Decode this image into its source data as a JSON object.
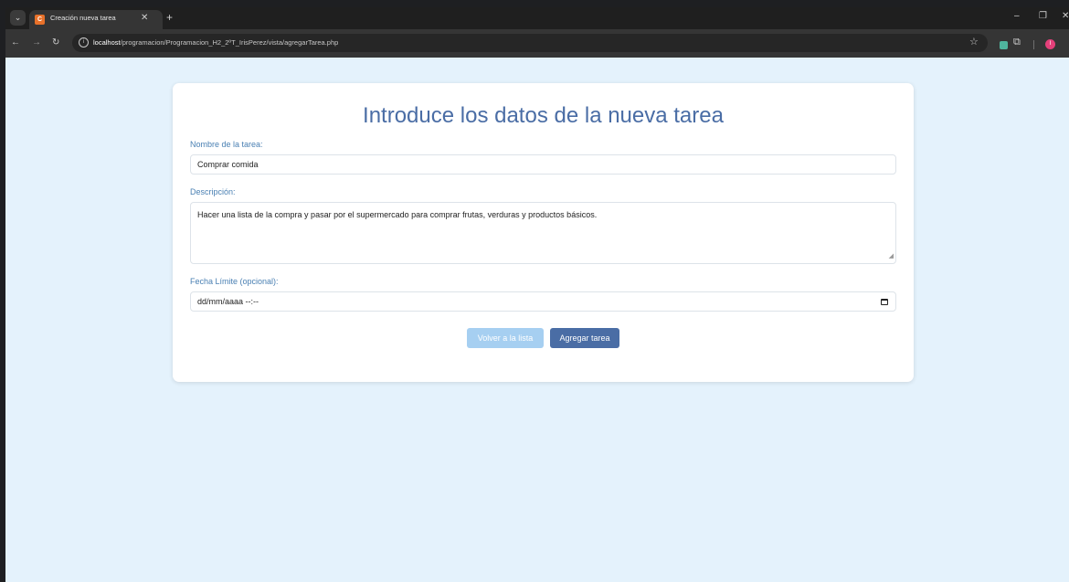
{
  "browser": {
    "tab_title": "Creación nueva tarea",
    "tab_favicon_letter": "C",
    "url_host": "localhost",
    "url_path": "/programacion/Programacion_H2_2ºT_IrisPerez/vista/agregarTarea.php",
    "profile_initial": "I",
    "icons": [
      "tab-search-icon",
      "close-icon",
      "plus-icon",
      "back-arrow-icon",
      "forward-arrow-icon",
      "reload-icon",
      "site-info-icon",
      "bookmark-star-icon",
      "extension-icon",
      "puzzle-icon",
      "minimize-icon",
      "maximize-icon",
      "window-close-icon"
    ]
  },
  "form": {
    "heading": "Introduce los datos de la nueva tarea",
    "name_label": "Nombre de la tarea:",
    "name_value": "Comprar comida",
    "description_label": "Descripción:",
    "description_value": "Hacer una lista de la compra y pasar por el supermercado para comprar frutas, verduras y productos básicos.",
    "date_label": "Fecha Límite (opcional):",
    "date_placeholder": "dd/mm/aaaa --:--",
    "back_button": "Volver a la lista",
    "submit_button": "Agregar tarea"
  },
  "colors": {
    "page_background": "#e4f2fc",
    "heading": "#4a6da5",
    "label": "#4a80b3",
    "primary_button": "#4a6da5",
    "secondary_button": "#a6cff1"
  }
}
